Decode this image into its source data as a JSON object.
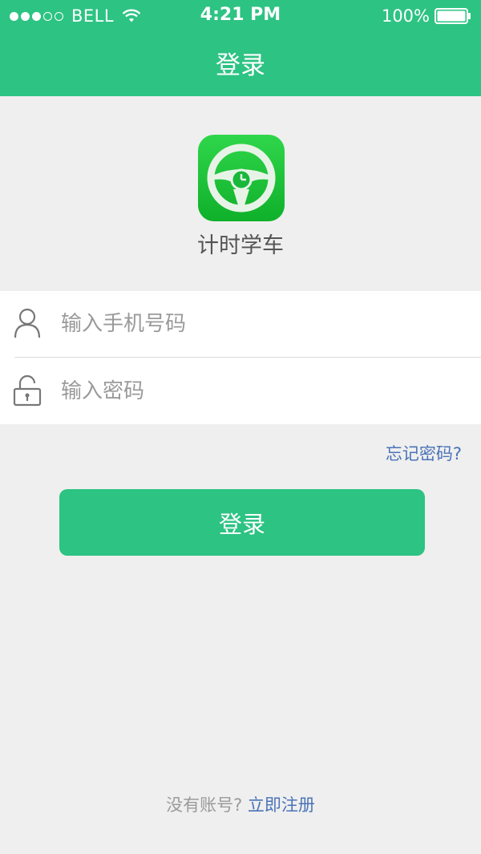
{
  "status_bar": {
    "carrier": "BELL",
    "time": "4:21 PM",
    "battery": "100%"
  },
  "header": {
    "title": "登录"
  },
  "app": {
    "name": "计时学车"
  },
  "form": {
    "phone_placeholder": "输入手机号码",
    "phone_value": "",
    "password_placeholder": "输入密码",
    "password_value": ""
  },
  "links": {
    "forgot_password": "忘记密码?"
  },
  "login_button": {
    "label": "登录"
  },
  "footer": {
    "no_account": "没有账号?",
    "register": "立即注册"
  },
  "colors": {
    "brand_green": "#2dc383",
    "link_blue": "#4a73b8",
    "background": "#efefef"
  },
  "icons": [
    "wifi-icon",
    "battery-icon",
    "steering-wheel-logo",
    "user-icon",
    "lock-icon"
  ]
}
